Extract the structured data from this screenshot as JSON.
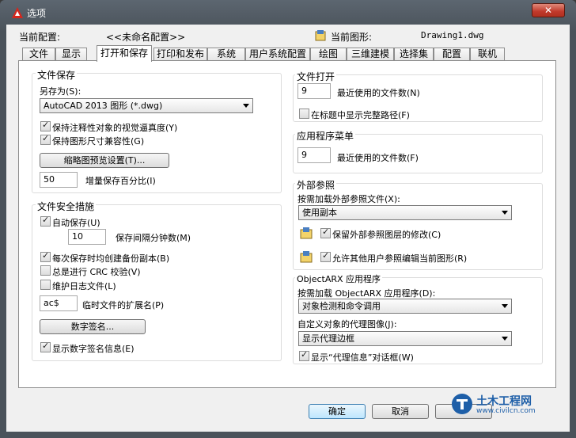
{
  "window": {
    "title": "选项",
    "close_label": "✕"
  },
  "header": {
    "profile_label": "当前配置:",
    "profile_value": "<<未命名配置>>",
    "drawing_label": "当前图形:",
    "drawing_value": "Drawing1.dwg"
  },
  "tabs": [
    "文件",
    "显示",
    "打开和保存",
    "打印和发布",
    "系统",
    "用户系统配置",
    "绘图",
    "三维建模",
    "选择集",
    "配置",
    "联机"
  ],
  "active_tab": "打开和保存",
  "file_save": {
    "title": "文件保存",
    "save_as_label": "另存为(S):",
    "save_as_value": "AutoCAD 2013 图形 (*.dwg)",
    "cb_annotative": "保持注释性对象的视觉逼真度(Y)",
    "cb_dim": "保持图形尺寸兼容性(G)",
    "thumb_button": "缩略图预览设置(T)...",
    "incremental_value": "50",
    "incremental_label": "增量保存百分比(I)"
  },
  "file_safety": {
    "title": "文件安全措施",
    "autosave_label": "自动保存(U)",
    "interval_value": "10",
    "interval_label": "保存间隔分钟数(M)",
    "backup_label": "每次保存时均创建备份副本(B)",
    "crc_label": "总是进行 CRC 校验(V)",
    "log_label": "维护日志文件(L)",
    "ext_value": "ac$",
    "ext_label": "临时文件的扩展名(P)",
    "sign_button": "数字签名...",
    "show_sign_label": "显示数字签名信息(E)"
  },
  "file_open": {
    "title": "文件打开",
    "recent_value": "9",
    "recent_label": "最近使用的文件数(N)",
    "fullpath_label": "在标题中显示完整路径(F)"
  },
  "app_menu": {
    "title": "应用程序菜单",
    "recent_value": "9",
    "recent_label": "最近使用的文件数(F)"
  },
  "xref": {
    "title": "外部参照",
    "demand_label": "按需加载外部参照文件(X):",
    "demand_value": "使用副本",
    "retain_label": "保留外部参照图层的修改(C)",
    "allow_label": "允许其他用户参照编辑当前图形(R)"
  },
  "arx": {
    "title": "ObjectARX 应用程序",
    "demand_label": "按需加载 ObjectARX 应用程序(D):",
    "demand_value": "对象检测和命令调用",
    "proxy_label": "自定义对象的代理图像(J):",
    "proxy_value": "显示代理边框",
    "proxy_dialog_label": "显示“代理信息”对话框(W)"
  },
  "footer": {
    "ok": "确定",
    "cancel": "取消"
  },
  "watermark": {
    "name": "土木工程网",
    "url": "www.civilcn.com"
  },
  "colors": {
    "accent": "#3c7fb1",
    "close": "#c0392b"
  }
}
